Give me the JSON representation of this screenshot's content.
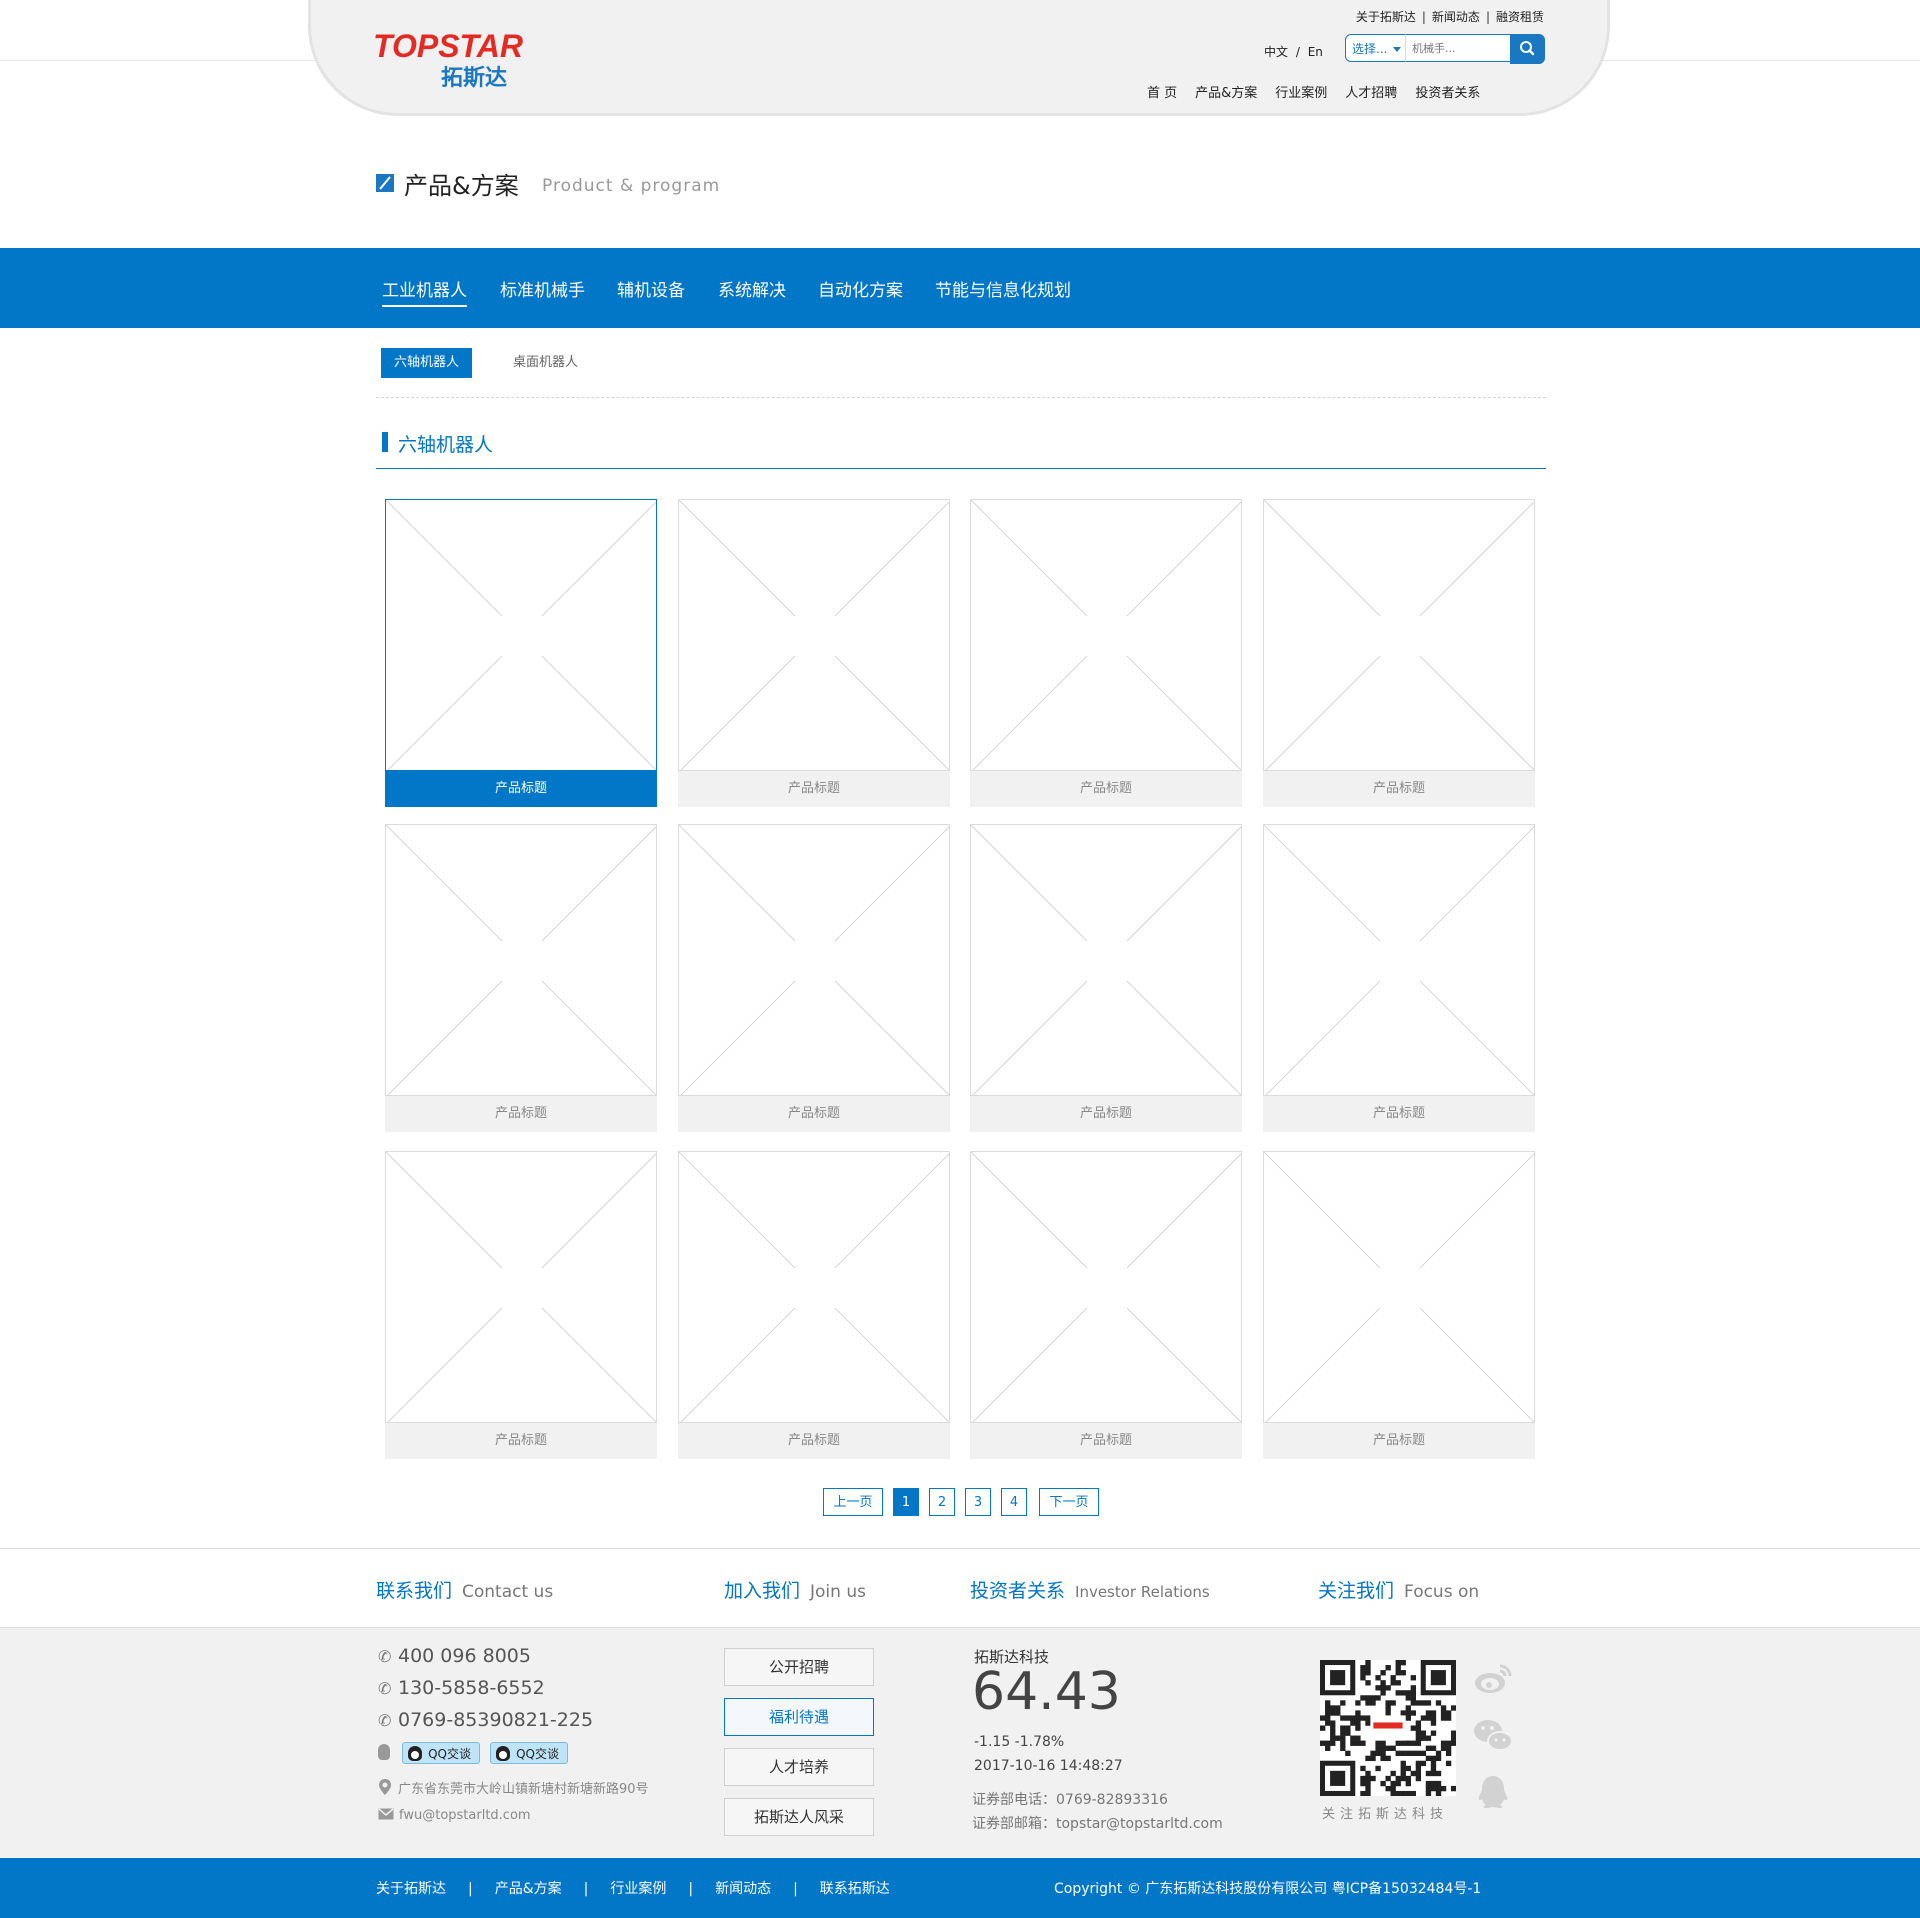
{
  "brand": {
    "logo_text": "TOPSTAR",
    "logo_cn": "拓斯达",
    "logo_color": "#e32b24",
    "accent": "#0276c7"
  },
  "top_links": [
    "关于拓斯达",
    "新闻动态",
    "融资租赁"
  ],
  "lang": {
    "cn": "中文",
    "sep": "/",
    "en": "En"
  },
  "search": {
    "select_label": "选择...",
    "placeholder": "机械手..."
  },
  "main_nav": [
    "首 页",
    "产品&方案",
    "行业案例",
    "人才招聘",
    "投资者关系"
  ],
  "page_title": {
    "cn": "产品&方案",
    "en": "Product & program"
  },
  "categories": [
    {
      "label": "工业机器人",
      "active": true
    },
    {
      "label": "标准机械手"
    },
    {
      "label": "辅机设备"
    },
    {
      "label": "系统解决"
    },
    {
      "label": "自动化方案"
    },
    {
      "label": "节能与信息化规划"
    }
  ],
  "subtabs": [
    {
      "label": "六轴机器人",
      "active": true
    },
    {
      "label": "桌面机器人"
    }
  ],
  "section_title": "六轴机器人",
  "products": [
    {
      "title": "产品标题",
      "active": true
    },
    {
      "title": "产品标题"
    },
    {
      "title": "产品标题"
    },
    {
      "title": "产品标题"
    },
    {
      "title": "产品标题"
    },
    {
      "title": "产品标题"
    },
    {
      "title": "产品标题"
    },
    {
      "title": "产品标题"
    },
    {
      "title": "产品标题"
    },
    {
      "title": "产品标题"
    },
    {
      "title": "产品标题"
    },
    {
      "title": "产品标题"
    }
  ],
  "pagination": {
    "prev": "上一页",
    "pages": [
      "1",
      "2",
      "3",
      "4"
    ],
    "current": "1",
    "next": "下一页"
  },
  "footer_heads": [
    {
      "cn": "联系我们",
      "en": "Contact us"
    },
    {
      "cn": "加入我们",
      "en": "Join us"
    },
    {
      "cn": "投资者关系",
      "en": "Investor Relations"
    },
    {
      "cn": "关注我们",
      "en": "Focus on"
    }
  ],
  "contact": {
    "phones": [
      "400 096 8005",
      "130-5858-6552",
      "0769-85390821-225"
    ],
    "qq_label": "QQ交谈",
    "address": "广东省东莞市大岭山镇新塘村新塘新路90号",
    "email": "fwu@topstarltd.com"
  },
  "join": [
    "公开招聘",
    "福利待遇",
    "人才培养",
    "拓斯达人风采"
  ],
  "join_active_index": 1,
  "stock": {
    "name": "拓斯达科技",
    "price": "64.43",
    "change": "-1.15  -1.78%",
    "time": "2017-10-16 14:48:27",
    "phone": "证券部电话：0769-82893316",
    "email": "证券部邮箱：topstar@topstarltd.com"
  },
  "follow": {
    "qr_label": "关注拓斯达科技",
    "icons": [
      "weibo-icon",
      "wechat-icon",
      "qq-icon"
    ]
  },
  "bottom_links": [
    "关于拓斯达",
    "产品&方案",
    "行业案例",
    "新闻动态",
    "联系拓斯达"
  ],
  "copyright": "Copyright © 广东拓斯达科技股份有限公司   粤ICP备15032484号-1"
}
